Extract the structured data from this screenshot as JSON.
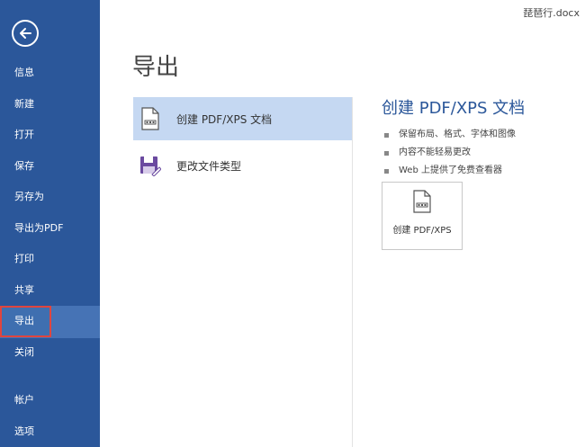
{
  "window": {
    "file_name": "琵琶行.docx"
  },
  "sidebar": {
    "items": [
      {
        "label": "信息"
      },
      {
        "label": "新建"
      },
      {
        "label": "打开"
      },
      {
        "label": "保存"
      },
      {
        "label": "另存为"
      },
      {
        "label": "导出为PDF"
      },
      {
        "label": "打印"
      },
      {
        "label": "共享"
      },
      {
        "label": "导出"
      },
      {
        "label": "关闭"
      }
    ],
    "bottom_items": [
      {
        "label": "帐户"
      },
      {
        "label": "选项"
      }
    ],
    "active_item": "导出",
    "colors": {
      "background": "#2b579a",
      "active": "#4673b5",
      "highlight_border": "#e0453e"
    }
  },
  "main": {
    "page_title": "导出",
    "options": [
      {
        "label": "创建 PDF/XPS 文档",
        "icon": "pdf-document-icon",
        "selected": true
      },
      {
        "label": "更改文件类型",
        "icon": "save-as-icon",
        "selected": false
      }
    ],
    "detail": {
      "title": "创建 PDF/XPS 文档",
      "bullets": [
        "保留布局、格式、字体和图像",
        "内容不能轻易更改",
        "Web 上提供了免费查看器"
      ],
      "button_label": "创建 PDF/XPS"
    },
    "colors": {
      "accent": "#2b579a",
      "selected_option": "#c5d8f2"
    }
  }
}
